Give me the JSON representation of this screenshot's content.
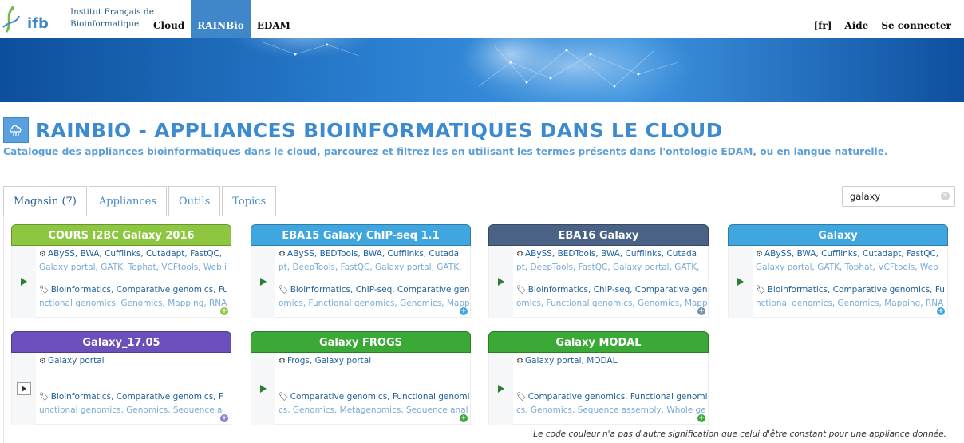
{
  "header": {
    "logo_text_1": "Institut Français de",
    "logo_text_2": "Bioinformatique",
    "nav": [
      {
        "label": "Cloud"
      },
      {
        "label": "RAINBio"
      },
      {
        "label": "EDAM"
      }
    ],
    "right_nav": [
      {
        "label": "[fr]"
      },
      {
        "label": "Aide"
      },
      {
        "label": "Se connecter"
      }
    ]
  },
  "page": {
    "title": "RAINBIO - APPLIANCES BIOINFORMATIQUES DANS LE CLOUD",
    "subtitle": "Catalogue des appliances bioinformatiques dans le cloud, parcourez et filtrez les en utilisant les termes présents dans l'ontologie EDAM, ou en langue naturelle."
  },
  "tabs": [
    {
      "label": "Magasin (7)"
    },
    {
      "label": "Appliances"
    },
    {
      "label": "Outils"
    },
    {
      "label": "Topics"
    }
  ],
  "search": {
    "value": "galaxy"
  },
  "cards": [
    {
      "title": "COURS I2BC Galaxy 2016",
      "color": "#8dc63f",
      "tools_line1": "ABySS, BWA, Cufflinks, Cutadapt, FastQC,",
      "tools_line2": "Galaxy portal, GATK, Tophat, VCFtools, Web i",
      "topics_line1": "Bioinformatics, Comparative genomics, Fu",
      "topics_line2": "nctional genomics, Genomics, Mapping, RNA",
      "plus_color": "#8dc63f"
    },
    {
      "title": "EBA15 Galaxy ChIP-seq 1.1",
      "color": "#3fa6e0",
      "tools_line1": "ABySS, BEDTools, BWA, Cufflinks, Cutada",
      "tools_line2": "pt, DeepTools, FastQC, Galaxy portal, GATK,",
      "topics_line1": "Bioinformatics, ChIP-seq, Comparative gen",
      "topics_line2": "omics, Functional genomics, Genomics, Mapp",
      "plus_color": "#3fa6e0"
    },
    {
      "title": "EBA16 Galaxy",
      "color": "#4a6285",
      "tools_line1": "ABySS, BEDTools, BWA, Cufflinks, Cutada",
      "tools_line2": "pt, DeepTools, FastQC, Galaxy portal, GATK,",
      "topics_line1": "Bioinformatics, ChIP-seq, Comparative gen",
      "topics_line2": "omics, Functional genomics, Genomics, Mapp",
      "plus_color": "#7a8ea8"
    },
    {
      "title": "Galaxy",
      "color": "#3fa6e0",
      "tools_line1": "ABySS, BWA, Cufflinks, Cutadapt, FastQC,",
      "tools_line2": "Galaxy portal, GATK, Tophat, VCFtools, Web i",
      "topics_line1": "Bioinformatics, Comparative genomics, Fu",
      "topics_line2": "nctional genomics, Genomics, Mapping, RNA",
      "plus_color": "#3fa6e0"
    },
    {
      "title": "Galaxy_17.05",
      "color": "#6b4fbb",
      "tools_line1": "Galaxy portal",
      "tools_line2": "",
      "topics_line1": "Bioinformatics, Comparative genomics, F",
      "topics_line2": "unctional genomics, Genomics, Sequence a",
      "plus_color": "#8e78c9"
    },
    {
      "title": "Galaxy FROGS",
      "color": "#3aa935",
      "tools_line1": "Frogs, Galaxy portal",
      "tools_line2": "",
      "topics_line1": "Comparative genomics, Functional genomi",
      "topics_line2": "cs, Genomics, Metagenomics, Sequence anal",
      "plus_color": "#3aa935"
    },
    {
      "title": "Galaxy MODAL",
      "color": "#3aa935",
      "tools_line1": "Galaxy portal, MODAL",
      "tools_line2": "",
      "topics_line1": "Comparative genomics, Functional genomi",
      "topics_line2": "cs, Genomics, Sequence assembly, Whole ge",
      "plus_color": "#3aa935"
    }
  ],
  "footnote": "Le code couleur n'a pas d'autre signification que celui d'être constant pour une appliance donnée."
}
